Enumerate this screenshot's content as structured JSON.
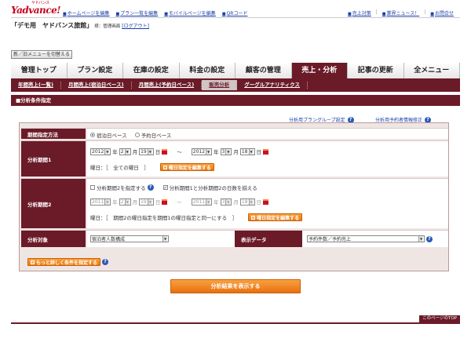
{
  "header": {
    "logo": "Yadvance!",
    "logo_kana": "ヤドバンス",
    "links": [
      "ホームページを編集",
      "プラン一覧を編集",
      "モバイルページを編集",
      "QRコード"
    ],
    "right_links": [
      "売上対策",
      "業界ニュース！",
      "お問合せ"
    ],
    "separator": "|",
    "hotel_name": "「デモ用　ヤドバンス旅館」",
    "user_suffix": "様：管理画面",
    "logout": "[ログアウト]",
    "mode_button": "新／旧メニューを切替える"
  },
  "main_nav": {
    "tabs": [
      "管理トップ",
      "プラン設定",
      "在庫の設定",
      "料金の設定",
      "顧客の管理",
      "売上・分析",
      "記事の更新",
      "全メニュー"
    ],
    "active_index": 5
  },
  "sub_nav": {
    "tabs": [
      "年間売上(一覧)",
      "月間売上(宿泊日ベース)",
      "月間売上(予約日ベース)",
      "販売分析",
      "グーグルアナリティクス"
    ],
    "active_index": 3
  },
  "section_title": "■分析条件指定",
  "help_links": {
    "plan_group": "分析用プラングループ設定",
    "reservation_info": "分析用予約者情報修正"
  },
  "form": {
    "period_method": {
      "label": "期間指定方法",
      "options": [
        "宿泊日ベース",
        "予約日ベース"
      ],
      "selected_index": 0
    },
    "period1": {
      "label": "分析期間1",
      "from": {
        "year": "2012",
        "month": "2",
        "day": "19"
      },
      "to": {
        "year": "2012",
        "month": "3",
        "day": "18"
      },
      "year_unit": "年",
      "month_unit": "月",
      "day_unit": "日",
      "tilde": "〜",
      "weekday_text": "曜日：［　全ての曜日　］",
      "weekday_button": "曜日指定を編集する"
    },
    "period2": {
      "label": "分析期間2",
      "enable_label": "分析期間2を指定する",
      "enable_checked": false,
      "align_label": "分析期間1と分析期間2の日数を揃える",
      "align_checked": true,
      "from": {
        "year": "2011",
        "month": "2",
        "day": "19"
      },
      "to": {
        "year": "2011",
        "month": "3",
        "day": "18"
      },
      "weekday_text": "曜日：［　期間2の曜日指定を期間1の曜日指定と同一にする　］",
      "weekday_button": "曜日指定を編集する"
    },
    "target": {
      "label": "分析対象",
      "value": "宿泊者人数構成",
      "display_label": "表示データ",
      "display_value": "予約件数／予約売上"
    },
    "more_button": "もっと詳しく条件を指定する"
  },
  "submit_button": "分析結果を表示する",
  "to_top": "このページのTOP",
  "icons": {
    "help": "?"
  }
}
